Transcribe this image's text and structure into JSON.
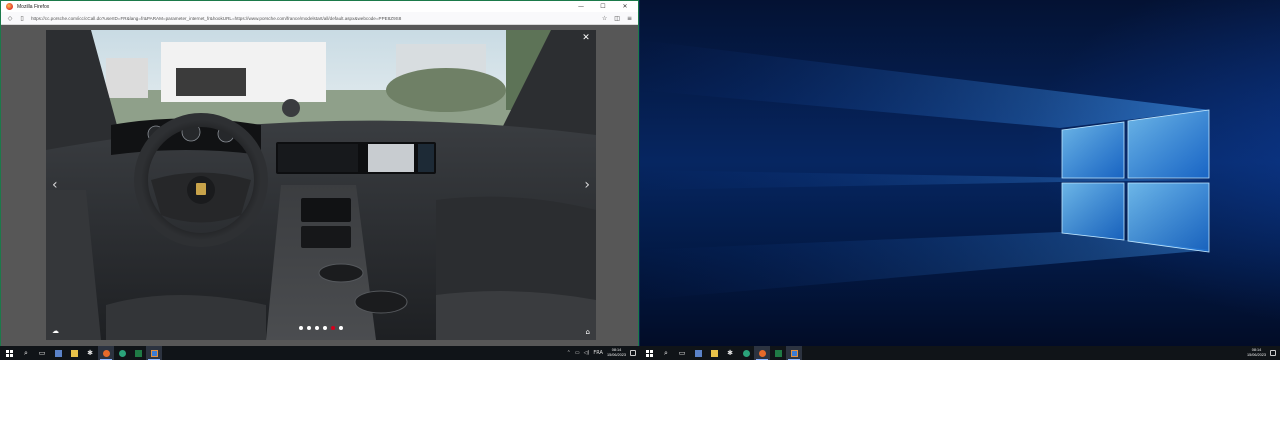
{
  "browser": {
    "title": "Mozilla Firefox",
    "url": "https://cc.porsche.com/icc/cCall.do?userID=FR&lang=fr&PARAM=parameter_internet_fr&hookURL=https://www.porsche.com/france/modelstart/all/default.aspx&webcode=PPE8Z9S8",
    "url_domain": "porsche.com"
  },
  "viewer": {
    "close_glyph": "✕",
    "prev_glyph": "‹",
    "next_glyph": "›",
    "dots": [
      false,
      false,
      false,
      false,
      true,
      false
    ],
    "corner_left_glyph": "☁",
    "corner_right_glyph": "⌂"
  },
  "taskbar_left": {
    "tray_language": "FRA",
    "time": "08:14",
    "date": "15/06/2023"
  },
  "taskbar_right": {
    "time": "08:14",
    "date": "15/06/2023"
  },
  "colors": {
    "taskbar_bg": "#101418",
    "accent_red": "#d5001c",
    "window_border": "#1b7a4a"
  }
}
